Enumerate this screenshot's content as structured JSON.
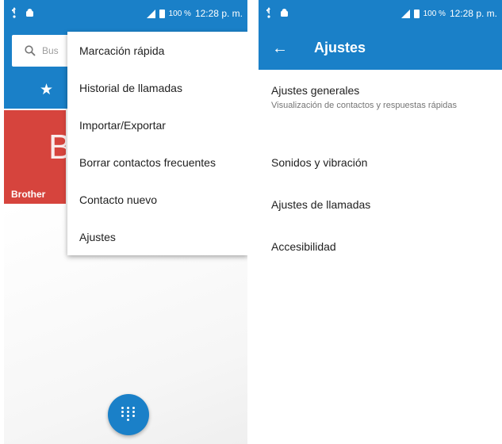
{
  "colors": {
    "primary": "#1a80c8",
    "contact_tile": "#d6443d",
    "accent_strip": "#f28b2c"
  },
  "status_bar": {
    "battery": "100 %",
    "time": "12:28 p. m."
  },
  "contacts": {
    "search_placeholder": "Bus",
    "favorites_tab_icon": "star-icon",
    "contact_tile": {
      "letter": "B",
      "name": "Brother"
    },
    "overflow_menu": [
      "Marcación rápida",
      "Historial de llamadas",
      "Importar/Exportar",
      "Borrar contactos frecuentes",
      "Contacto nuevo",
      "Ajustes"
    ],
    "fab_icon": "dialpad-icon"
  },
  "settings": {
    "title": "Ajustes",
    "back_icon": "back-arrow-icon",
    "items": [
      {
        "title": "Ajustes generales",
        "subtitle": "Visualización de contactos y respuestas rápidas"
      },
      {
        "title": "Sonidos y vibración"
      },
      {
        "title": "Ajustes de llamadas"
      },
      {
        "title": "Accesibilidad"
      }
    ]
  }
}
